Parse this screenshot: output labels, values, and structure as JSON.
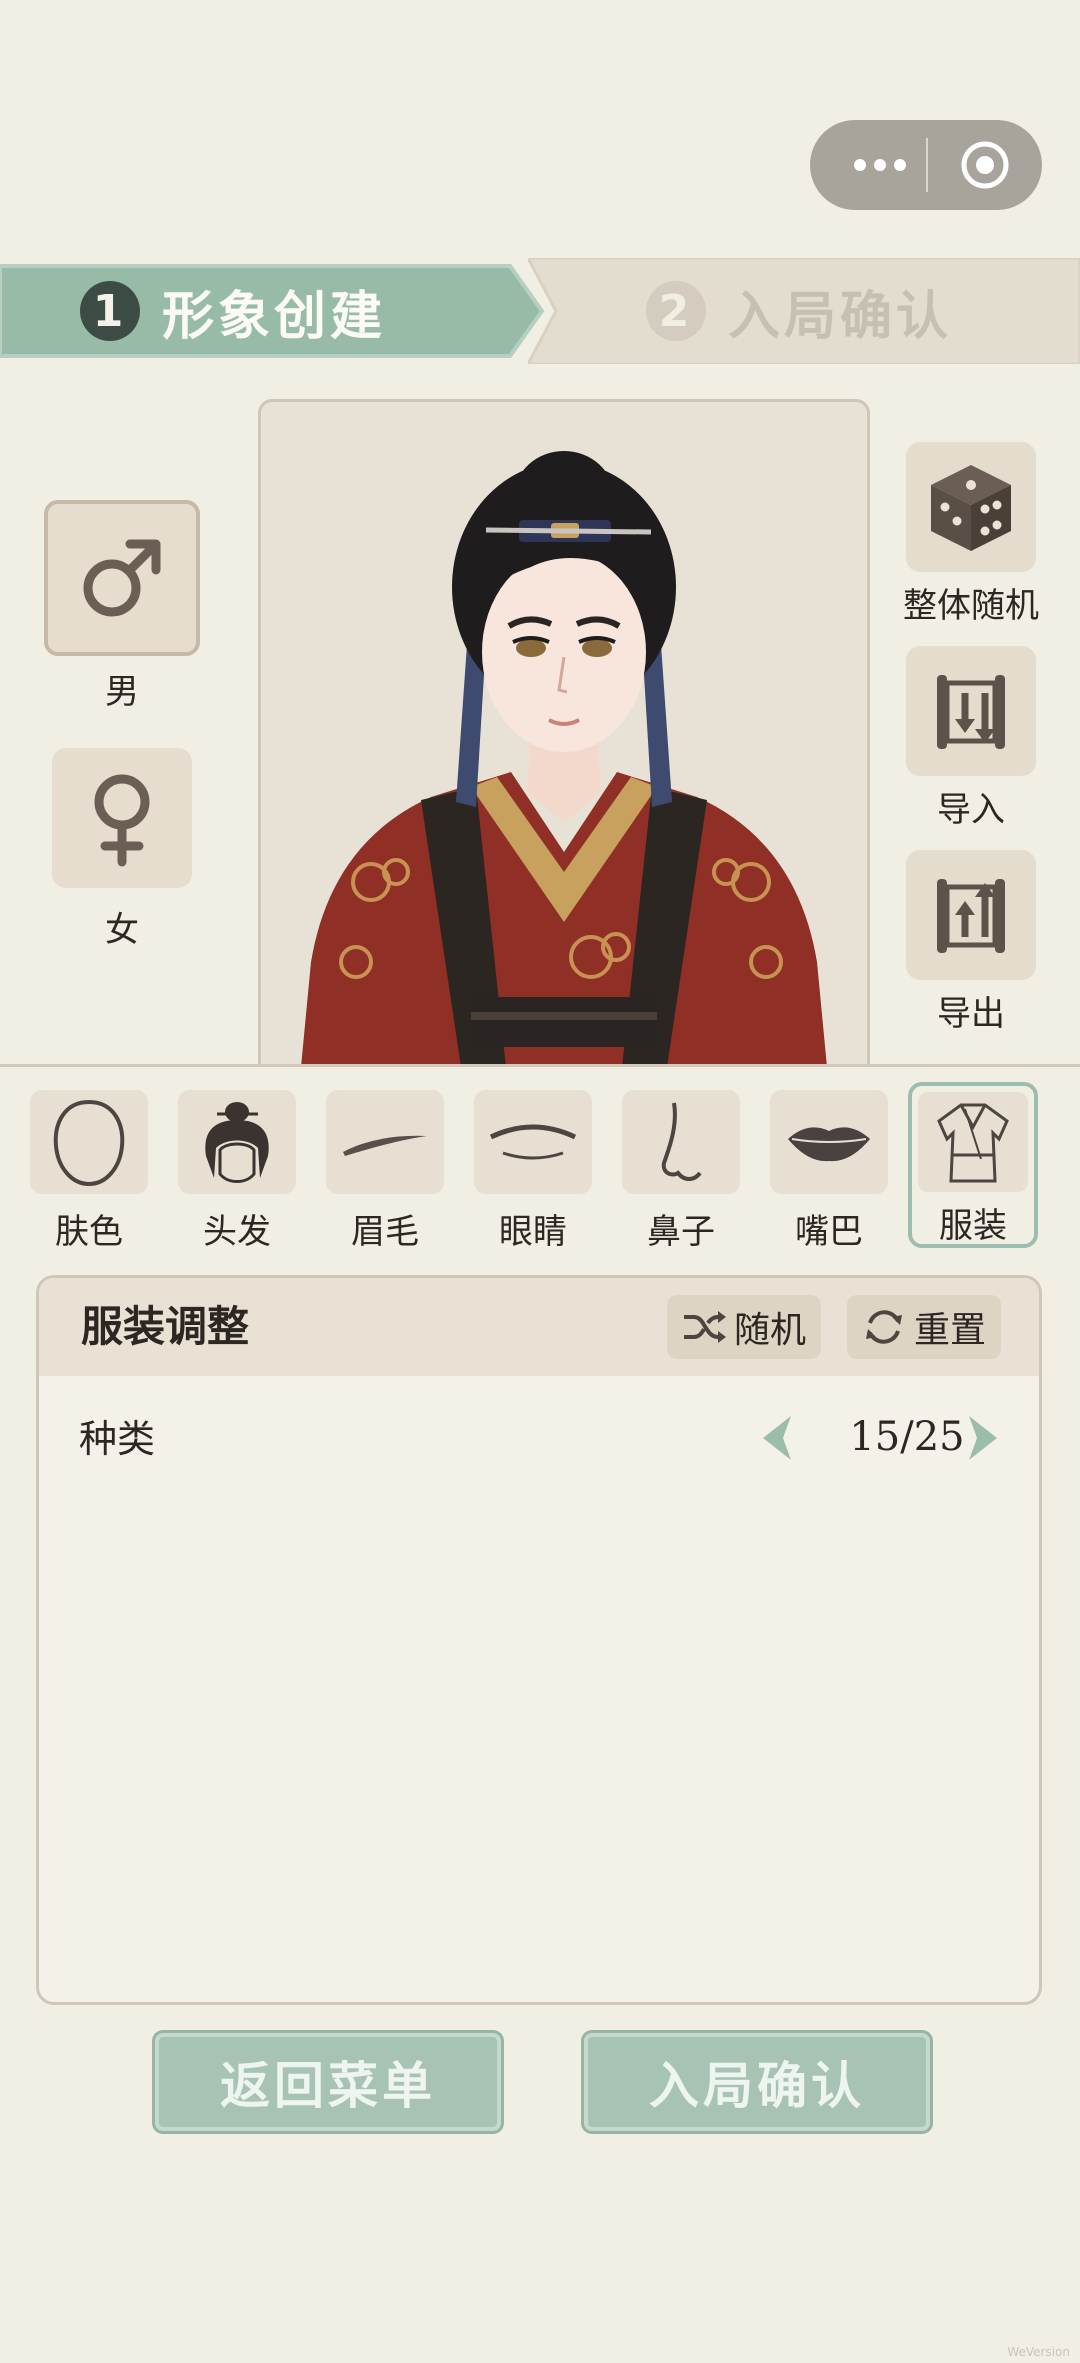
{
  "capsule": {
    "more_icon": "more-dots-icon",
    "close_icon": "target-circle-icon"
  },
  "steps": [
    {
      "number": "1",
      "label": "形象创建",
      "active": true
    },
    {
      "number": "2",
      "label": "入局确认",
      "active": false
    }
  ],
  "gender": [
    {
      "label": "男",
      "icon": "male-symbol-icon",
      "selected": true
    },
    {
      "label": "女",
      "icon": "female-symbol-icon",
      "selected": false
    }
  ],
  "actions": [
    {
      "label": "整体随机",
      "icon": "dice-icon"
    },
    {
      "label": "导入",
      "icon": "scroll-import-icon"
    },
    {
      "label": "导出",
      "icon": "scroll-export-icon"
    }
  ],
  "features": [
    {
      "label": "肤色",
      "icon": "face-outline-icon"
    },
    {
      "label": "头发",
      "icon": "hair-bun-icon"
    },
    {
      "label": "眉毛",
      "icon": "eyebrow-icon"
    },
    {
      "label": "眼睛",
      "icon": "eye-icon"
    },
    {
      "label": "鼻子",
      "icon": "nose-icon"
    },
    {
      "label": "嘴巴",
      "icon": "lips-icon"
    },
    {
      "label": "服装",
      "icon": "robe-icon",
      "selected": true
    }
  ],
  "panel": {
    "title": "服装调整",
    "random_label": "随机",
    "reset_label": "重置",
    "row_label": "种类",
    "counter": "15/25"
  },
  "bottom": {
    "back_label": "返回菜单",
    "confirm_label": "入局确认"
  },
  "watermark": "WeVersion",
  "colors": {
    "accent": "#9bbdaa",
    "panel_bg": "#f4f1e8",
    "page_bg": "#f1eee3"
  }
}
